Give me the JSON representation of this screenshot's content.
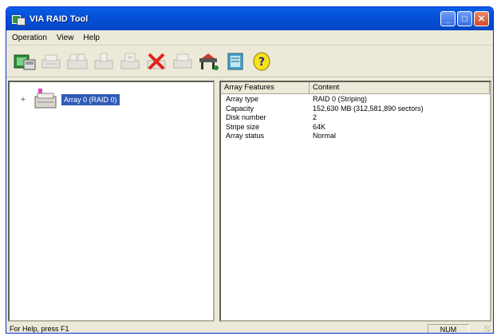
{
  "window": {
    "title": "VIA RAID Tool"
  },
  "menu": [
    "Operation",
    "View",
    "Help"
  ],
  "toolbar": [
    {
      "name": "scan-icon",
      "tooltip": ""
    },
    {
      "name": "create-array-icon"
    },
    {
      "name": "create-array-multi-icon"
    },
    {
      "name": "add-disk-icon"
    },
    {
      "name": "duplicate-icon"
    },
    {
      "name": "delete-icon"
    },
    {
      "name": "printer-icon"
    },
    {
      "name": "settings-icon"
    },
    {
      "name": "refresh-icon"
    },
    {
      "name": "help-icon"
    }
  ],
  "tree": {
    "expander": "+",
    "node_label": "Array 0 (RAID 0)"
  },
  "list": {
    "headers": [
      "Array Features",
      "Content"
    ],
    "rows": [
      [
        "Array type",
        "RAID 0 (Striping)"
      ],
      [
        "Capacity",
        "152,630 MB (312,581,890 sectors)"
      ],
      [
        "Disk number",
        "2"
      ],
      [
        "Stripe size",
        "64K"
      ],
      [
        "Array status",
        "Normal"
      ]
    ]
  },
  "status": {
    "help_text": "For Help, press F1",
    "num": "NUM"
  },
  "colors": {
    "title_bar": "#0550d8",
    "selection": "#2f5bb7",
    "chrome": "#ece9d8"
  }
}
